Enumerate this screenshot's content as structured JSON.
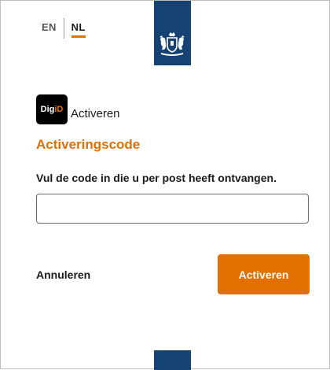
{
  "language_switcher": {
    "en_label": "EN",
    "nl_label": "NL",
    "active": "NL"
  },
  "branding": {
    "logo_text_a": "Dig",
    "logo_text_b": "iD",
    "service_label": "Activeren",
    "emblem_icon": "rijksoverheid-coat-of-arms-icon"
  },
  "form": {
    "title": "Activeringscode",
    "instruction": "Vul de code in die u per post heeft ontvangen.",
    "code_value": "",
    "code_placeholder": ""
  },
  "actions": {
    "cancel_label": "Annuleren",
    "submit_label": "Activeren"
  },
  "colors": {
    "accent": "#e17000",
    "banner": "#154273",
    "text": "#1a1a1a"
  }
}
